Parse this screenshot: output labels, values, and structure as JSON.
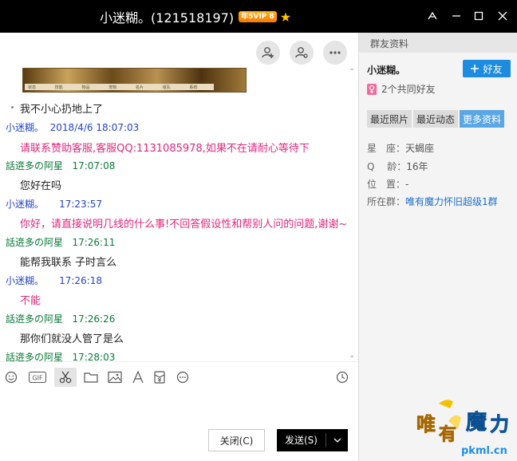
{
  "window": {
    "title": "小迷糊。(121518197)",
    "vip_badge": "年5VIP 8"
  },
  "chat": {
    "messages": [
      {
        "type": "text",
        "text": "我不小心扔地上了"
      },
      {
        "type": "header",
        "sender": "小迷糊。",
        "time": "2018/4/6 18:07:03"
      },
      {
        "type": "text",
        "text": "请联系赞助客服,客服QQ:1131085978,如果不在请耐心等待下"
      },
      {
        "type": "header",
        "sender": "話逩多の阿星",
        "time": "17:07:08"
      },
      {
        "type": "text",
        "text": "您好在吗"
      },
      {
        "type": "header",
        "sender": "小迷糊。",
        "time": "17:23:57"
      },
      {
        "type": "text",
        "text": "你好，请直接说明几线的什么事!不回答假设性和帮别人问的问题,谢谢~"
      },
      {
        "type": "header",
        "sender": "話逩多の阿星",
        "time": "17:26:11"
      },
      {
        "type": "text",
        "text": "能帮我联系 子时言么"
      },
      {
        "type": "header",
        "sender": "小迷糊。",
        "time": "17:26:18"
      },
      {
        "type": "text",
        "text": "不能"
      },
      {
        "type": "header",
        "sender": "話逩多の阿星",
        "time": "17:26:26"
      },
      {
        "type": "text",
        "text": "那你们就没人管了是么"
      },
      {
        "type": "header",
        "sender": "話逩多の阿星",
        "time": "17:28:03"
      }
    ],
    "game_menu": [
      "状态",
      "技能",
      "物品",
      "宠物",
      "名片",
      "组队",
      "系统"
    ]
  },
  "footer": {
    "close_label": "关闭(C)",
    "send_label": "发送(S)"
  },
  "side": {
    "header": "群友资料",
    "name": "小迷糊。",
    "add_friend": "好友",
    "common_friends": "2个共同好友",
    "tabs": [
      "最近照片",
      "最近动态",
      "更多资料"
    ],
    "info": {
      "constellation_label": "星　座：",
      "constellation": "天蝎座",
      "age_label": "Q　 龄：",
      "age": "16年",
      "location_label": "位　置：",
      "location": "-",
      "group_label": "所在群：",
      "group": "唯有魔力怀旧超级1群"
    },
    "logo_text": "唯有魔力",
    "logo_url": "pkml.cn"
  },
  "colors": {
    "title_bg": "#000000",
    "accent": "#1d8ce0",
    "sender_blue": "#2444c8",
    "sender_green": "#0a7a3a",
    "reply_pink": "#e0287c"
  }
}
